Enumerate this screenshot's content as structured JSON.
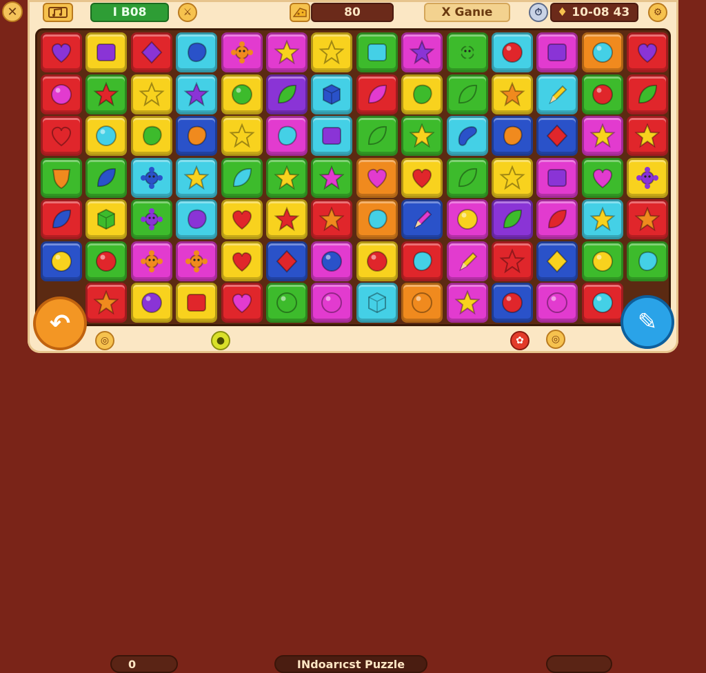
{
  "topbar": {
    "close_label": "✕",
    "level_label": "I B08",
    "swords_label": "⚔",
    "score_value": "80",
    "mode_label": "X Ganıe",
    "timer_value": "10-08 43",
    "settings_label": "⚙"
  },
  "bottom": {
    "coins_value": "0",
    "title": "INdoarıcst Puzzle",
    "undo_label": "↶",
    "tool_label": "✎"
  },
  "board": {
    "rows": 7,
    "cols": 14,
    "tiles": [
      [
        "red:heart:purple",
        "yellow:square:purple",
        "red:diamond:purple",
        "cyan:blob:blue",
        "magenta:flower:orange",
        "magenta:star:yellow",
        "yellow:star:yellow",
        "green:square:cyan",
        "magenta:star:purple",
        "green:flower:green",
        "cyan:circle:red",
        "magenta:square:purple",
        "orange:circle:cyan",
        "red:heart:purple"
      ],
      [
        "red:circle:magenta",
        "green:star:red",
        "yellow:star:yellow",
        "cyan:star:purple",
        "yellow:circle:green",
        "purple:leaf:green",
        "cyan:cube:blue",
        "red:leaf:magenta",
        "yellow:blob:green",
        "green:leaf:green",
        "yellow:star:orange",
        "cyan:pen:yellow",
        "green:circle:red",
        "red:leaf:green"
      ],
      [
        "red:heart:red",
        "yellow:circle:cyan",
        "yellow:blob:green",
        "blue:blob:orange",
        "yellow:star:yellow",
        "magenta:blob:cyan",
        "cyan:square:purple",
        "green:leaf:green",
        "green:star:yellow",
        "cyan:wave:blue",
        "blue:blob:orange",
        "blue:diamond:red",
        "magenta:star:yellow",
        "red:star:yellow"
      ],
      [
        "green:shield:orange",
        "green:leaf:blue",
        "cyan:flower:blue",
        "cyan:star:yellow",
        "green:leaf:cyan",
        "green:star:yellow",
        "green:star:magenta",
        "orange:heart:magenta",
        "yellow:heart:red",
        "green:leaf:green",
        "yellow:star:yellow",
        "magenta:square:purple",
        "green:heart:magenta",
        "yellow:flower:purple"
      ],
      [
        "red:leaf:blue",
        "yellow:cube:green",
        "green:flower:purple",
        "cyan:blob:purple",
        "yellow:heart:red",
        "yellow:star:red",
        "red:star:orange",
        "orange:blob:cyan",
        "blue:pen:magenta",
        "magenta:circle:yellow",
        "purple:leaf:green",
        "magenta:leaf:red",
        "cyan:star:yellow",
        "red:star:orange"
      ],
      [
        "blue:circle:yellow",
        "green:circle:red",
        "magenta:flower:orange",
        "magenta:flower:orange",
        "yellow:heart:red",
        "blue:diamond:red",
        "magenta:circle:blue",
        "yellow:circle:red",
        "red:blob:cyan",
        "magenta:pen:yellow",
        "red:star:red",
        "blue:diamond:yellow",
        "green:circle:yellow",
        "green:blob:cyan"
      ],
      [
        "none",
        "red:star:orange",
        "yellow:circle:purple",
        "yellow:square:red",
        "red:heart:magenta",
        "green:circle:green",
        "magenta:circle:magenta",
        "cyan:cube:cyan",
        "orange:circle:orange",
        "magenta:star:yellow",
        "blue:circle:red",
        "magenta:circle:magenta",
        "red:circle:cyan",
        "none"
      ]
    ]
  },
  "colors": {
    "red": "#e0262b",
    "yellow": "#f8d21e",
    "green": "#3dbb2c",
    "cyan": "#44d0e6",
    "magenta": "#e23bcf",
    "blue": "#2a52c9",
    "orange": "#f08a1e",
    "purple": "#8a34d6",
    "none": "transparent"
  }
}
